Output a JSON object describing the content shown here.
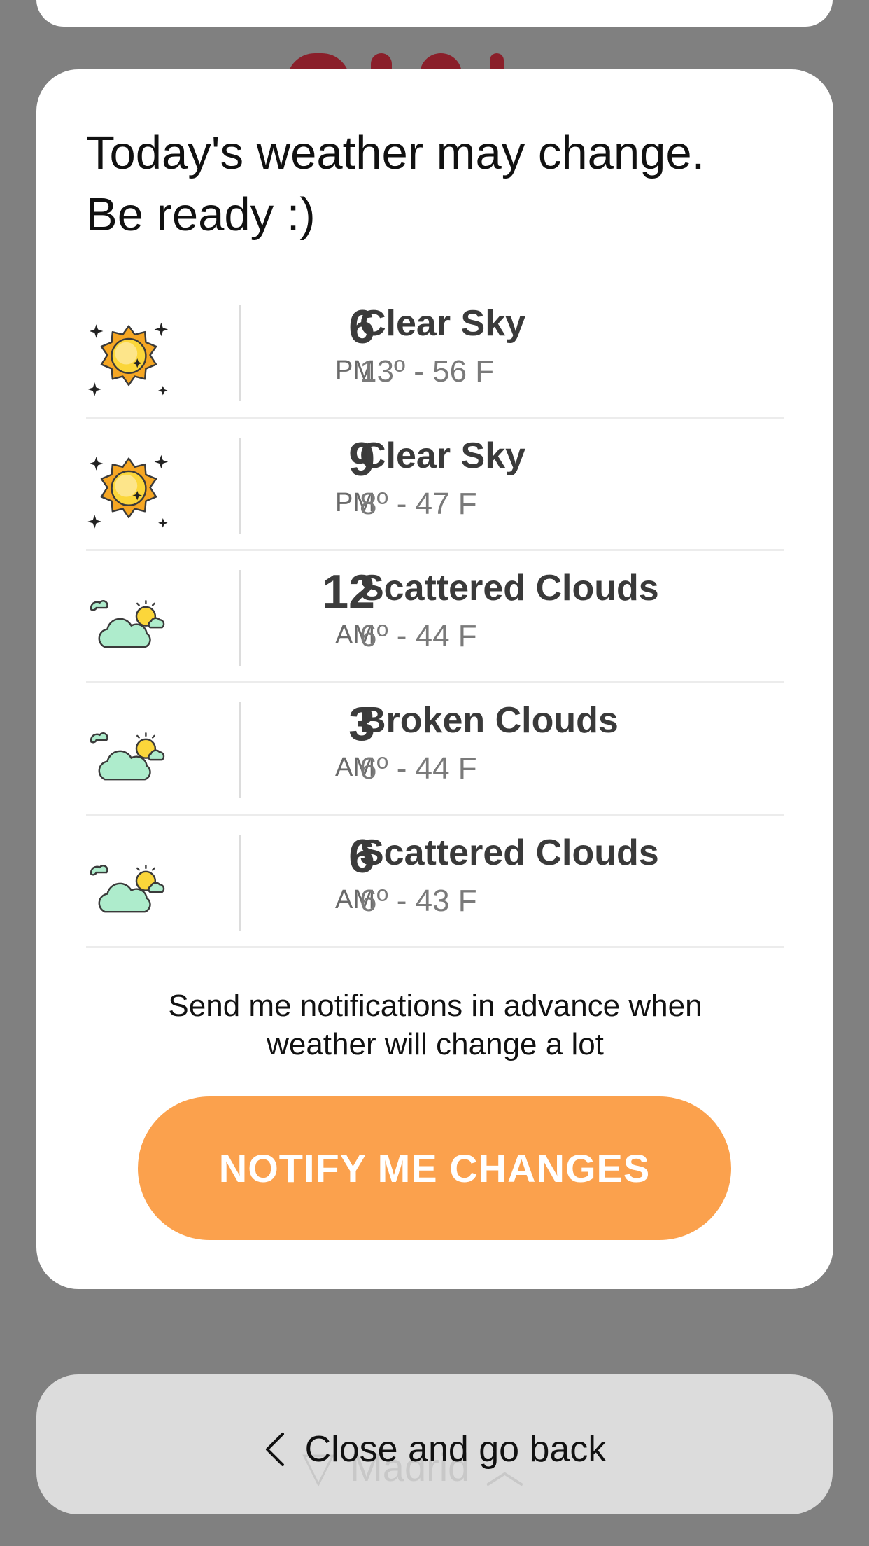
{
  "modal": {
    "title_line1": "Today's weather may change.",
    "title_line2": "Be ready :)",
    "forecast": [
      {
        "hour": "6",
        "period": "PM",
        "condition": "Clear Sky",
        "temp": "13º - 56 F",
        "icon": "clear-sky-icon"
      },
      {
        "hour": "9",
        "period": "PM",
        "condition": "Clear Sky",
        "temp": "8º - 47 F",
        "icon": "clear-sky-icon"
      },
      {
        "hour": "12",
        "period": "AM",
        "condition": "Scattered Clouds",
        "temp": "6º - 44 F",
        "icon": "scattered-clouds-icon"
      },
      {
        "hour": "3",
        "period": "AM",
        "condition": "Broken Clouds",
        "temp": "6º - 44 F",
        "icon": "broken-clouds-icon"
      },
      {
        "hour": "6",
        "period": "AM",
        "condition": "Scattered Clouds",
        "temp": "6º - 43 F",
        "icon": "scattered-clouds-icon"
      }
    ],
    "notify_text_line1": "Send me notifications in advance when",
    "notify_text_line2": "weather will change a lot",
    "notify_button": "NOTIFY ME CHANGES"
  },
  "bottom": {
    "close_label": "Close and go back",
    "city": "Madrid"
  },
  "colors": {
    "accent": "#fba14d",
    "overlay": "#808080",
    "sun_fill": "#fbd63a",
    "sun_ring": "#f5a623",
    "cloud_fill": "#aeeccc"
  }
}
